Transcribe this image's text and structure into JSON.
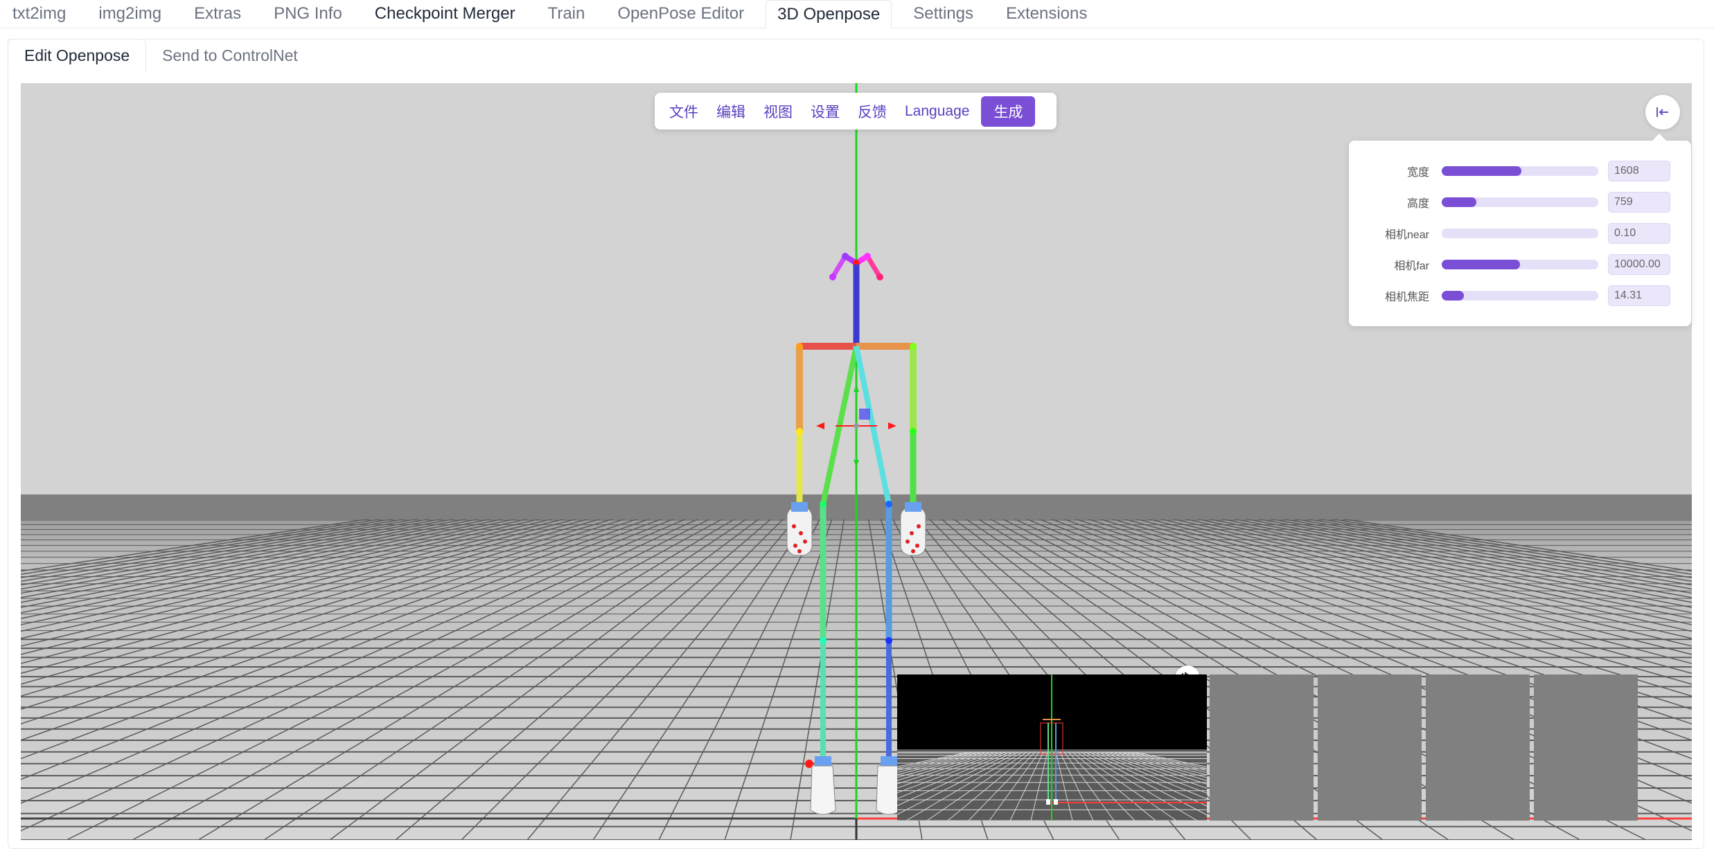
{
  "top_tabs": [
    {
      "label": "txt2img"
    },
    {
      "label": "img2img"
    },
    {
      "label": "Extras"
    },
    {
      "label": "PNG Info"
    },
    {
      "label": "Checkpoint Merger"
    },
    {
      "label": "Train"
    },
    {
      "label": "OpenPose Editor"
    },
    {
      "label": "3D Openpose"
    },
    {
      "label": "Settings"
    },
    {
      "label": "Extensions"
    }
  ],
  "active_top_tab": "3D Openpose",
  "sub_tabs": [
    {
      "label": "Edit Openpose"
    },
    {
      "label": "Send to ControlNet"
    }
  ],
  "menu": [
    {
      "label": "文件"
    },
    {
      "label": "编辑"
    },
    {
      "label": "视图"
    },
    {
      "label": "设置"
    },
    {
      "label": "反馈"
    },
    {
      "label": "Language"
    },
    {
      "label": "生成"
    }
  ],
  "settings": [
    {
      "label": "宽度",
      "value": "1608",
      "fill": 0.51
    },
    {
      "label": "高度",
      "value": "759",
      "fill": 0.22
    },
    {
      "label": "相机near",
      "value": "0.10",
      "fill": 0.0
    },
    {
      "label": "相机far",
      "value": "10000.00",
      "fill": 0.5
    },
    {
      "label": "相机焦距",
      "value": "14.31",
      "fill": 0.14
    }
  ],
  "icons": {
    "collapse": "collapse-left-icon",
    "play": "play-next-icon",
    "lock": "unlock-icon",
    "undo": "undo-icon"
  },
  "colors": {
    "accent": "#7a4fd6",
    "viewport_bg": "#d3d3d3",
    "ground": "#808080",
    "axis_green": "#00e000"
  }
}
